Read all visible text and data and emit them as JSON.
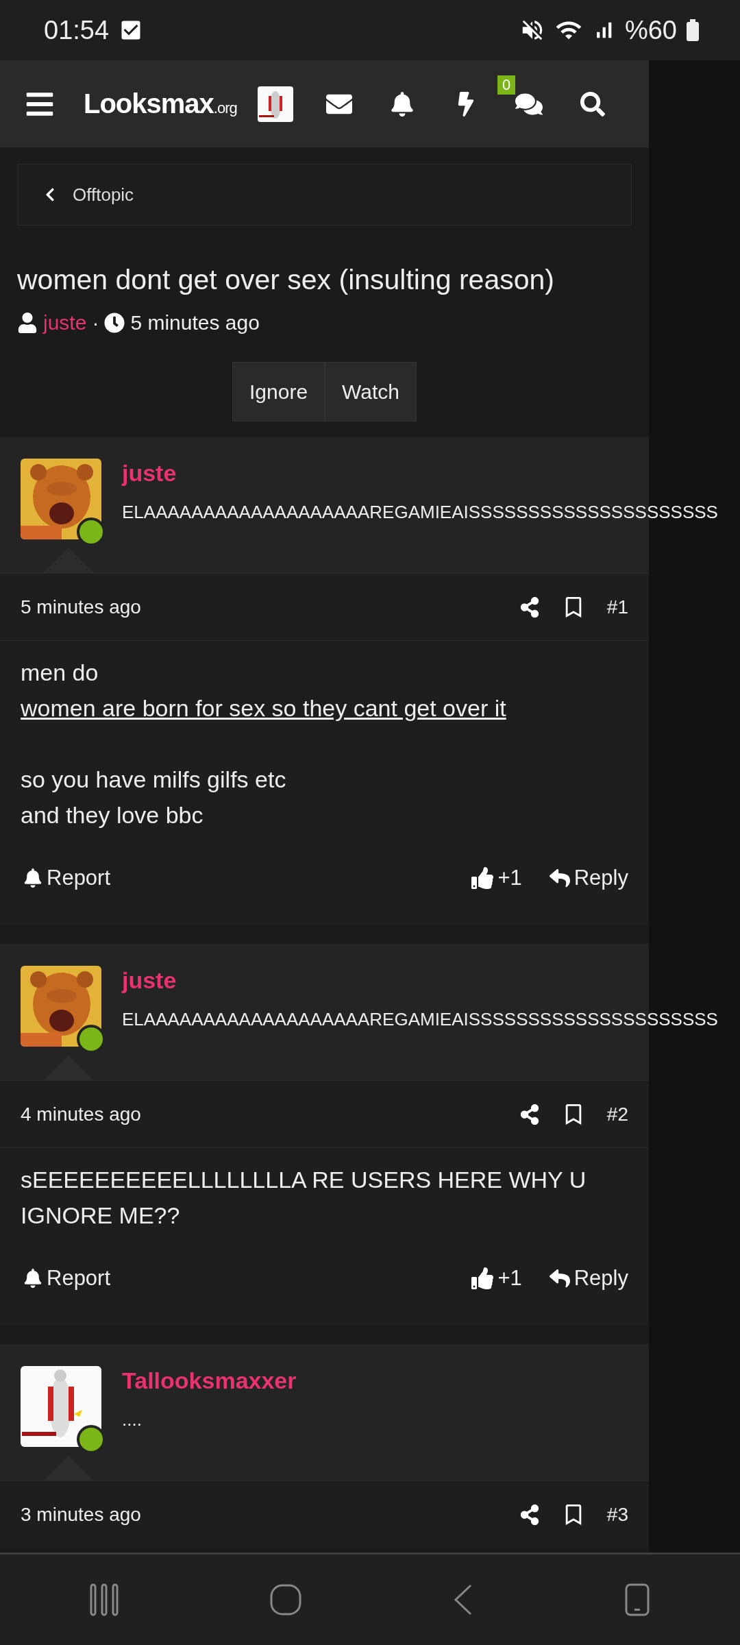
{
  "status_bar": {
    "time": "01:54",
    "battery": "%60"
  },
  "header": {
    "logo": {
      "name": "Looksmax",
      "suffix": ".org"
    },
    "chat_badge": "0"
  },
  "breadcrumb": {
    "label": "Offtopic"
  },
  "thread": {
    "title": "women dont get over sex (insulting reason)",
    "author": "juste",
    "separator": "·",
    "time": "5 minutes ago"
  },
  "thread_buttons": [
    "Ignore",
    "Watch"
  ],
  "posts": [
    {
      "author": "juste",
      "online": true,
      "signature": "ELAAAAAAAAAAAAAAAAAAAREGAMIEAISSSSSSSSSSSSSSSSSSSSS",
      "time": "5 minutes ago",
      "number": "#1",
      "paragraphs": [
        [
          {
            "text": "men do",
            "underlined": false
          },
          {
            "text": "women are born for sex so they cant get over it",
            "underlined": true
          }
        ],
        [
          {
            "text": "so you have milfs gilfs etc",
            "underlined": false
          },
          {
            "text": "and they love bbc",
            "underlined": false
          }
        ]
      ],
      "report": "Report",
      "reactions": "+1",
      "reply": "Reply"
    },
    {
      "author": "juste",
      "online": true,
      "signature": "ELAAAAAAAAAAAAAAAAAAAREGAMIEAISSSSSSSSSSSSSSSSSSSSS",
      "time": "4 minutes ago",
      "number": "#2",
      "paragraphs": [
        [
          {
            "text": "sEEEEEEEEEELLLLLLLLA RE USERS HERE WHY U IGNORE ME??",
            "underlined": false
          }
        ]
      ],
      "report": "Report",
      "reactions": "+1",
      "reply": "Reply"
    },
    {
      "author": "Tallooksmaxxer",
      "online": true,
      "signature": "....",
      "time": "3 minutes ago",
      "number": "#3"
    }
  ]
}
